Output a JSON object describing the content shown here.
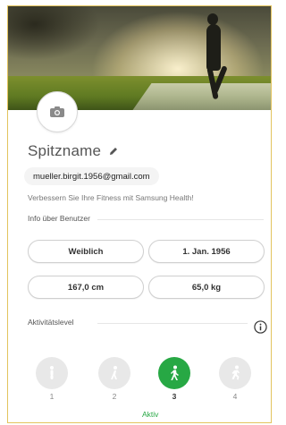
{
  "profile": {
    "nickname": "Spitzname",
    "email": "mueller.birgit.1956@gmail.com",
    "promo": "Verbessern Sie Ihre Fitness mit Samsung Health!"
  },
  "user_info": {
    "section_title": "Info über Benutzer",
    "gender": "Weiblich",
    "birthdate": "1. Jan. 1956",
    "height": "167,0 cm",
    "weight": "65,0 kg"
  },
  "activity": {
    "section_title": "Aktivitätslevel",
    "levels": [
      {
        "number": "1",
        "icon": "sitting-person-icon"
      },
      {
        "number": "2",
        "icon": "standing-person-icon"
      },
      {
        "number": "3",
        "icon": "walking-person-icon"
      },
      {
        "number": "4",
        "icon": "running-person-icon"
      }
    ],
    "selected_index": 2,
    "selected_label": "Aktiv"
  },
  "colors": {
    "accent_green": "#27a844",
    "frame_border": "#e3c45e"
  },
  "icons": {
    "camera": "camera-icon",
    "pencil": "pencil-icon",
    "info": "info-icon"
  }
}
